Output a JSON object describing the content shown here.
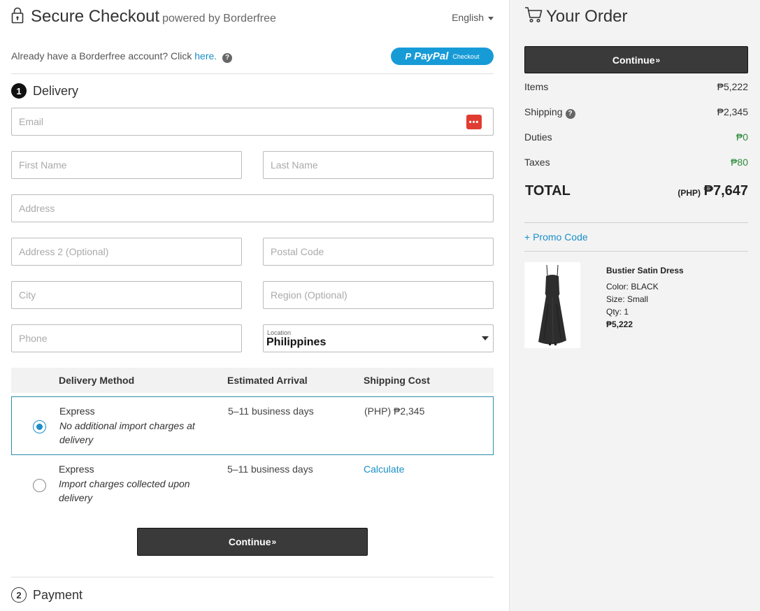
{
  "header": {
    "title": "Secure Checkout",
    "powered_by": "powered by Borderfree",
    "language": "English"
  },
  "account": {
    "prompt": "Already have a Borderfree account? Click",
    "link": "here."
  },
  "paypal": {
    "logo": "PayPal",
    "label": "Checkout",
    "color": "#179bd7"
  },
  "delivery": {
    "step_number": "1",
    "title": "Delivery",
    "fields": {
      "email": "Email",
      "first_name": "First Name",
      "last_name": "Last Name",
      "address": "Address",
      "address2": "Address 2 (Optional)",
      "postal_code": "Postal Code",
      "city": "City",
      "region": "Region (Optional)",
      "phone": "Phone",
      "location_label": "Location",
      "location_value": "Philippines"
    },
    "method_table": {
      "headers": [
        "Delivery Method",
        "Estimated Arrival",
        "Shipping Cost"
      ],
      "rows": [
        {
          "name": "Express",
          "desc": "No additional import charges at delivery",
          "arrival": "5–11 business days",
          "cost": "(PHP) ₱2,345",
          "selected": true
        },
        {
          "name": "Express",
          "desc": "Import charges collected upon delivery",
          "arrival": "5–11 business days",
          "cost": "Calculate",
          "selected": false
        }
      ]
    },
    "continue_label": "Continue",
    "continue_chevron": "»"
  },
  "payment": {
    "step_number": "2",
    "title": "Payment"
  },
  "order": {
    "title": "Your Order",
    "continue_label": "Continue",
    "continue_chevron": "»",
    "items_label": "Items",
    "items_value": "₱5,222",
    "shipping_label": "Shipping",
    "shipping_value": "₱2,345",
    "duties_label": "Duties",
    "duties_value": "₱0",
    "taxes_label": "Taxes",
    "taxes_value": "₱80",
    "total_label": "TOTAL",
    "total_currency": "(PHP)",
    "total_value": "₱7,647",
    "promo_label": "+ Promo Code",
    "product": {
      "name": "Bustier Satin Dress",
      "color": "Color: BLACK",
      "size": "Size: Small",
      "qty": "Qty: 1",
      "price": "₱5,222"
    }
  },
  "colors": {
    "accent_link": "#1a8fc9",
    "selected_border": "#2a8fa8",
    "button_dark": "#3a3a3a",
    "green_value": "#2e8b3a",
    "sidebar_bg": "#f3f3f3"
  }
}
